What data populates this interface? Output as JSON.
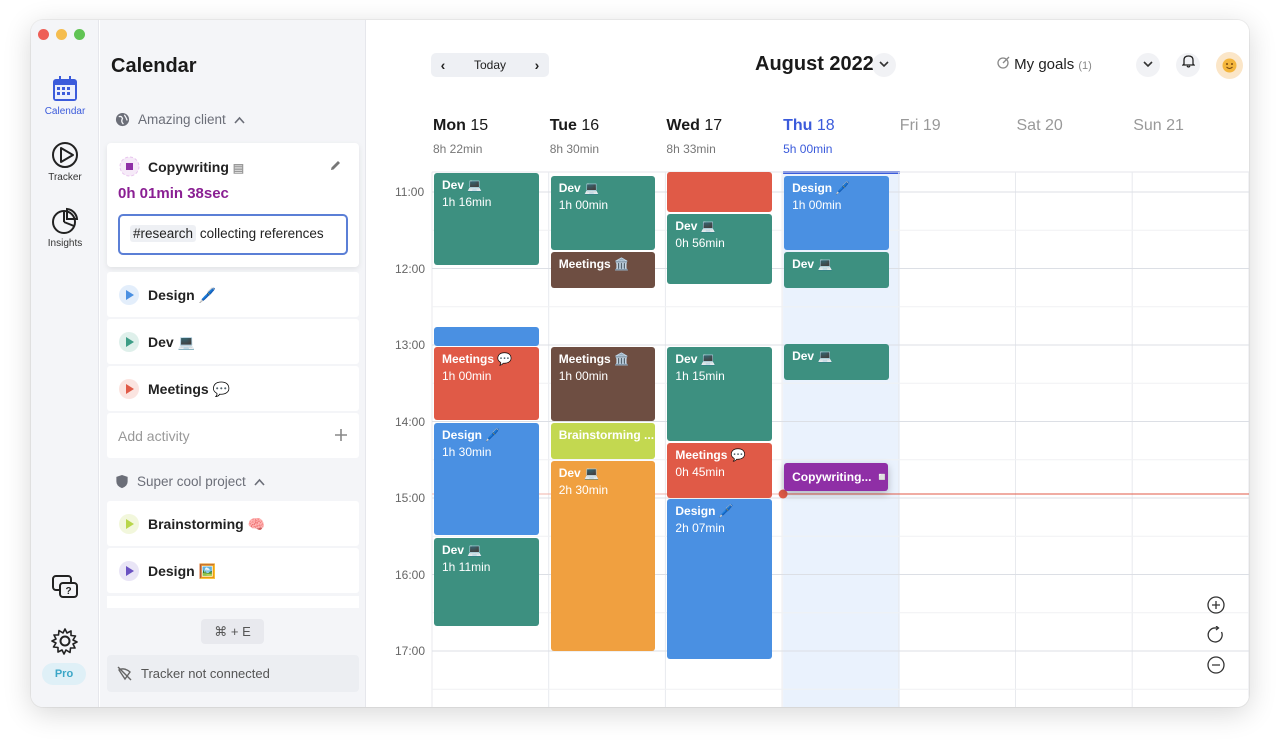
{
  "nav_rail": {
    "items": [
      {
        "label": "Calendar",
        "icon": "calendar-icon"
      },
      {
        "label": "Tracker",
        "icon": "tracker-icon"
      },
      {
        "label": "Insights",
        "icon": "pie-chart-icon"
      }
    ],
    "pro_label": "Pro"
  },
  "sidebar": {
    "title": "Calendar",
    "client_group": "Amazing client",
    "active": {
      "name": "Copywriting",
      "timer": "0h 01min 38sec",
      "tag": "#research",
      "note": "collecting references"
    },
    "client_items": [
      {
        "label": "Design",
        "emoji": "🖊️",
        "color": "#4a90e2"
      },
      {
        "label": "Dev",
        "emoji": "💻",
        "color": "#3d9d86"
      },
      {
        "label": "Meetings",
        "emoji": "💬",
        "color": "#e05a47"
      }
    ],
    "add_activity": "Add activity",
    "project_group": "Super cool project",
    "project_items": [
      {
        "label": "Brainstorming",
        "emoji": "🧠",
        "color": "#b8d64a"
      },
      {
        "label": "Design",
        "emoji": "🖼️",
        "color": "#6a52c2"
      }
    ],
    "shortcut": "⌘ + E",
    "tracker_status": "Tracker not connected"
  },
  "header": {
    "today": "Today",
    "month": "August 2022",
    "goals": "My goals",
    "goals_count": "(1)"
  },
  "days": [
    {
      "name": "Mon",
      "num": "15",
      "hours": "8h 22min"
    },
    {
      "name": "Tue",
      "num": "16",
      "hours": "8h 30min"
    },
    {
      "name": "Wed",
      "num": "17",
      "hours": "8h 33min"
    },
    {
      "name": "Thu",
      "num": "18",
      "hours": "5h 00min"
    },
    {
      "name": "Fri",
      "num": "19",
      "hours": ""
    },
    {
      "name": "Sat",
      "num": "20",
      "hours": ""
    },
    {
      "name": "Sun",
      "num": "21",
      "hours": ""
    }
  ],
  "hours": [
    "11:00",
    "12:00",
    "13:00",
    "14:00",
    "15:00",
    "16:00",
    "17:00"
  ],
  "events": [
    {
      "day": 0,
      "title": "Dev 💻",
      "duration": "1h 16min",
      "color": "#3d9080"
    },
    {
      "day": 0,
      "title": "",
      "duration": "",
      "color": "#4a90e2"
    },
    {
      "day": 0,
      "title": "Meetings 💬",
      "duration": "1h 00min",
      "color": "#e05a47"
    },
    {
      "day": 0,
      "title": "Design 🖊️",
      "duration": "1h 30min",
      "color": "#4a90e2"
    },
    {
      "day": 0,
      "title": "Dev 💻",
      "duration": "1h 11min",
      "color": "#3d9080"
    },
    {
      "day": 1,
      "title": "Dev 💻",
      "duration": "1h 00min",
      "color": "#3d9080"
    },
    {
      "day": 1,
      "title": "Meetings 🏛️",
      "duration": "",
      "color": "#6e4e42"
    },
    {
      "day": 1,
      "title": "Meetings 🏛️",
      "duration": "1h 00min",
      "color": "#6e4e42"
    },
    {
      "day": 1,
      "title": "Brainstorming ...",
      "duration": "",
      "color": "#c3d850"
    },
    {
      "day": 1,
      "title": "Dev 💻",
      "duration": "2h 30min",
      "color": "#f0a040"
    },
    {
      "day": 2,
      "title": "",
      "duration": "",
      "color": "#e05a47"
    },
    {
      "day": 2,
      "title": "Dev 💻",
      "duration": "0h 56min",
      "color": "#3d9080"
    },
    {
      "day": 2,
      "title": "Dev 💻",
      "duration": "1h 15min",
      "color": "#3d9080"
    },
    {
      "day": 2,
      "title": "Meetings 💬",
      "duration": "0h 45min",
      "color": "#e05a47"
    },
    {
      "day": 2,
      "title": "Design 🖊️",
      "duration": "2h 07min",
      "color": "#4a90e2"
    },
    {
      "day": 3,
      "title": "Design 🖊️",
      "duration": "1h 00min",
      "color": "#4a90e2"
    },
    {
      "day": 3,
      "title": "Dev 💻",
      "duration": "",
      "color": "#3d9080"
    },
    {
      "day": 3,
      "title": "Dev 💻",
      "duration": "",
      "color": "#3d9080"
    },
    {
      "day": 3,
      "title": "Copywriting... ◽",
      "duration": "",
      "color": "#8f2fa6"
    }
  ],
  "colors": {
    "accent": "#3b5bdb",
    "now_line": "#e05a47"
  }
}
